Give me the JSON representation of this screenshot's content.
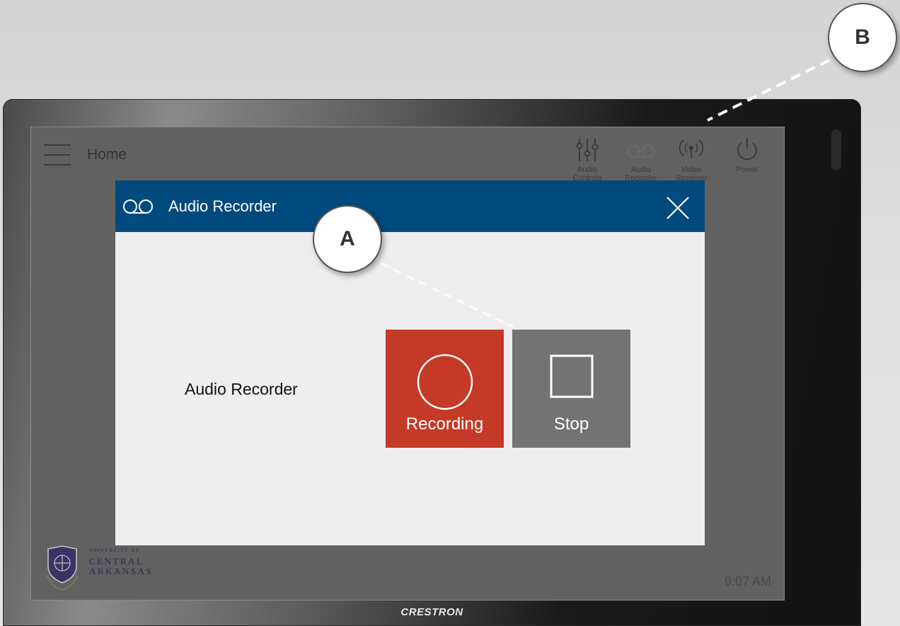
{
  "device": {
    "brand": "CRESTRON"
  },
  "header": {
    "menu_icon": "hamburger-icon",
    "title": "Home",
    "icons": [
      {
        "name": "Audio Controls",
        "line1": "Audio",
        "line2": "Controls",
        "icon": "sliders-icon"
      },
      {
        "name": "Audio Recorder",
        "line1": "Audio",
        "line2": "Recorder",
        "icon": "voicemail-icon"
      },
      {
        "name": "Video Streamer",
        "line1": "Video",
        "line2": "Streamer",
        "icon": "broadcast-icon"
      },
      {
        "name": "Power",
        "line1": "Power",
        "line2": "",
        "icon": "power-icon"
      }
    ]
  },
  "dialog": {
    "title": "Audio Recorder",
    "icon": "voicemail-icon",
    "close_icon": "close-icon",
    "row_label": "Audio Recorder",
    "record_label": "Recording",
    "stop_label": "Stop",
    "record_color": "#c53a27",
    "stop_color": "#737373",
    "header_color": "#004a7d"
  },
  "footer": {
    "logo_small": "UNIVERSITY OF",
    "logo_line1": "CENTRAL",
    "logo_line2": "ARKANSAS",
    "time": "9:07 AM"
  },
  "callouts": {
    "a": "A",
    "b": "B"
  }
}
